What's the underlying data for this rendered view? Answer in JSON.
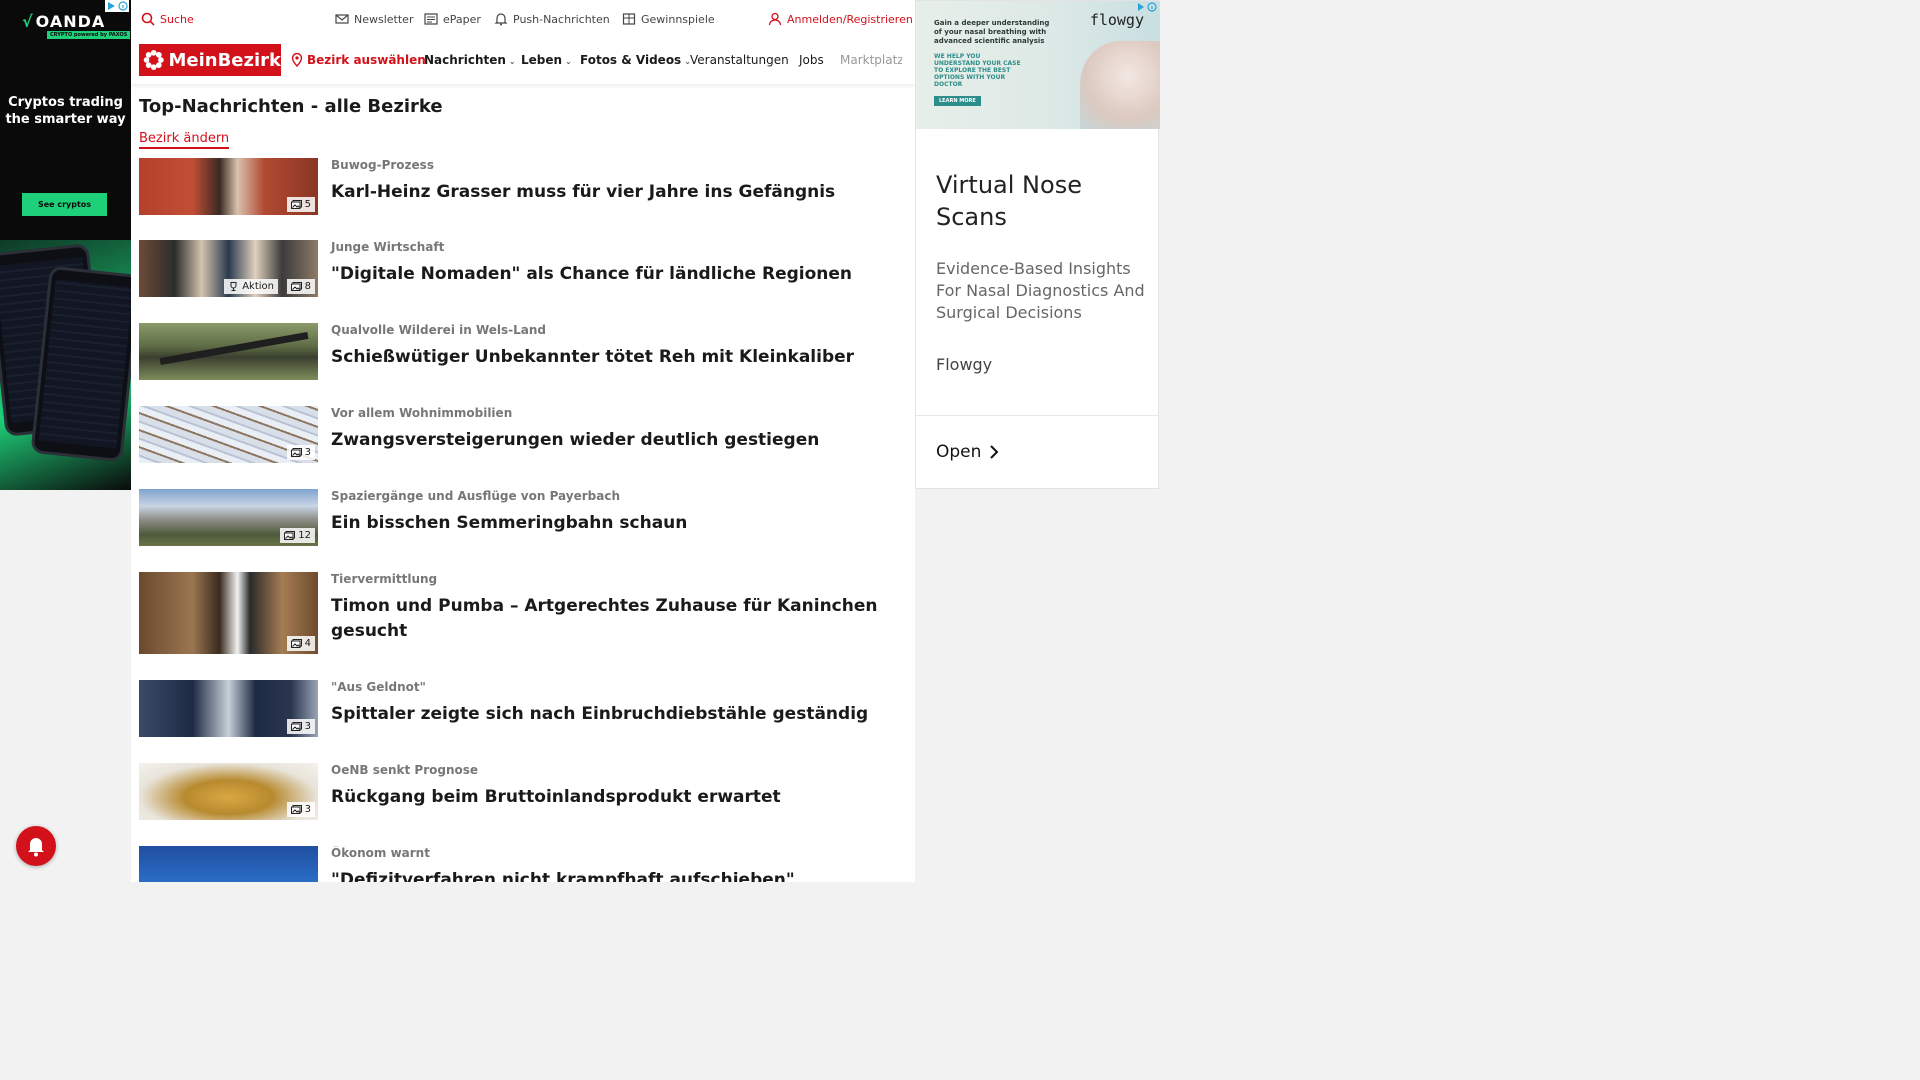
{
  "left_ad": {
    "brand": "OANDA",
    "brand_sub": "CRYPTO powered by PAXOS",
    "tagline": "Cryptos trading the smarter way",
    "cta": "See cryptos"
  },
  "topbar": {
    "search": "Suche",
    "newsletter": "Newsletter",
    "epaper": "ePaper",
    "push": "Push-Nachrichten",
    "games": "Gewinnspiele",
    "login": "Anmelden/Registrieren"
  },
  "nav": {
    "logo": "MeinBezirk",
    "select_district": "Bezirk auswählen",
    "items": [
      "Nachrichten",
      "Leben",
      "Fotos & Videos",
      "Veranstaltungen",
      "Jobs",
      "Marktplatz"
    ]
  },
  "section": {
    "title": "Top-Nachrichten - alle Bezirke",
    "change_district": "Bezirk ändern"
  },
  "articles": [
    {
      "kicker": "Buwog-Prozess",
      "headline": "Karl-Heinz Grasser muss für vier Jahre ins Gefängnis",
      "count": "5"
    },
    {
      "kicker": "Junge Wirtschaft",
      "headline": "\"Digitale Nomaden\" als Chance für ländliche Regionen",
      "count": "8",
      "tag": "Aktion"
    },
    {
      "kicker": "Qualvolle Wilderei in Wels-Land",
      "headline": "Schießwütiger Unbekannter tötet Reh mit Kleinkaliber"
    },
    {
      "kicker": "Vor allem Wohnimmobilien",
      "headline": "Zwangsversteigerungen wieder deutlich gestiegen",
      "count": "3"
    },
    {
      "kicker": "Spaziergänge und Ausflüge von Payerbach",
      "headline": "Ein bisschen Semmeringbahn schaun",
      "count": "12"
    },
    {
      "kicker": "Tiervermittlung",
      "headline": "Timon und Pumba – Artgerechtes Zuhause für Kaninchen gesucht",
      "count": "4"
    },
    {
      "kicker": "\"Aus Geldnot\"",
      "headline": "Spittaler zeigte sich nach Einbruchdiebstähle geständig",
      "count": "3"
    },
    {
      "kicker": "OeNB senkt Prognose",
      "headline": "Rückgang beim Bruttoinlandsprodukt erwartet",
      "count": "3"
    },
    {
      "kicker": "Ökonom warnt",
      "headline": "\"Defizitverfahren nicht krampfhaft aufschieben\""
    }
  ],
  "right_ad": {
    "banner_text": "Gain a deeper understanding of your nasal breathing with advanced scientific analysis",
    "banner_sub": "WE HELP YOU UNDERSTAND YOUR CASE TO EXPLORE THE BEST OPTIONS WITH YOUR DOCTOR",
    "banner_btn": "LEARN MORE",
    "banner_logo": "flowgy",
    "title": "Virtual Nose Scans",
    "description": "Evidence-Based Insights For Nasal Diagnostics And Surgical Decisions",
    "brand": "Flowgy",
    "open": "Open"
  },
  "colors": {
    "brand_red": "#d3111b",
    "oanda_green": "#1fd07a"
  }
}
